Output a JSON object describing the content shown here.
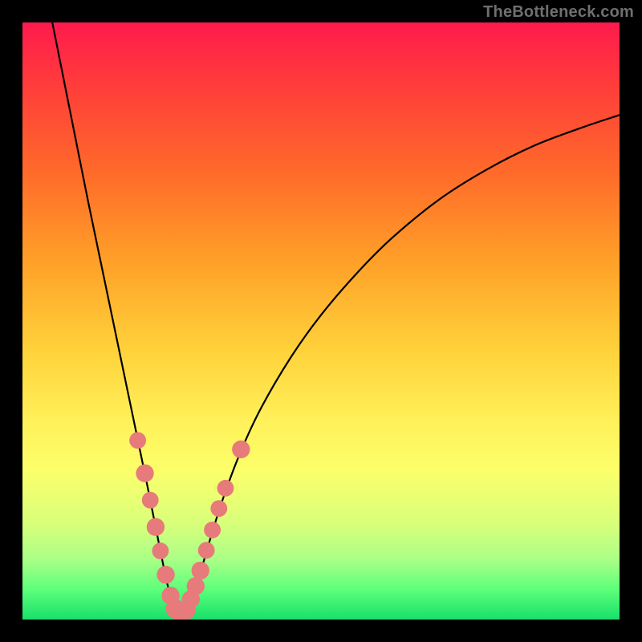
{
  "watermark": "TheBottleneck.com",
  "chart_data": {
    "type": "line",
    "title": "",
    "xlabel": "",
    "ylabel": "",
    "xlim": [
      0,
      100
    ],
    "ylim": [
      0,
      100
    ],
    "note": "Bottleneck-style V curve. X and Y are relative percentages of the plot area. Minimum (best match) is near x≈26.",
    "curve": [
      {
        "x": 5.0,
        "y": 100.0
      },
      {
        "x": 7.0,
        "y": 90.0
      },
      {
        "x": 9.0,
        "y": 80.0
      },
      {
        "x": 11.0,
        "y": 70.0
      },
      {
        "x": 13.5,
        "y": 58.0
      },
      {
        "x": 16.0,
        "y": 46.0
      },
      {
        "x": 18.5,
        "y": 34.0
      },
      {
        "x": 21.0,
        "y": 22.0
      },
      {
        "x": 23.0,
        "y": 12.0
      },
      {
        "x": 24.5,
        "y": 5.0
      },
      {
        "x": 26.0,
        "y": 1.0
      },
      {
        "x": 27.5,
        "y": 1.0
      },
      {
        "x": 29.0,
        "y": 5.0
      },
      {
        "x": 31.0,
        "y": 12.0
      },
      {
        "x": 33.5,
        "y": 20.0
      },
      {
        "x": 36.5,
        "y": 28.0
      },
      {
        "x": 40.0,
        "y": 35.5
      },
      {
        "x": 45.0,
        "y": 44.0
      },
      {
        "x": 50.0,
        "y": 51.0
      },
      {
        "x": 56.0,
        "y": 58.0
      },
      {
        "x": 62.0,
        "y": 64.0
      },
      {
        "x": 70.0,
        "y": 70.5
      },
      {
        "x": 78.0,
        "y": 75.5
      },
      {
        "x": 86.0,
        "y": 79.5
      },
      {
        "x": 94.0,
        "y": 82.5
      },
      {
        "x": 100.0,
        "y": 84.5
      }
    ],
    "markers": [
      {
        "x": 19.3,
        "y": 30.0,
        "r": 1.4
      },
      {
        "x": 20.5,
        "y": 24.5,
        "r": 1.5
      },
      {
        "x": 21.4,
        "y": 20.0,
        "r": 1.4
      },
      {
        "x": 22.3,
        "y": 15.5,
        "r": 1.5
      },
      {
        "x": 23.1,
        "y": 11.5,
        "r": 1.4
      },
      {
        "x": 24.0,
        "y": 7.5,
        "r": 1.5
      },
      {
        "x": 24.8,
        "y": 4.0,
        "r": 1.5
      },
      {
        "x": 25.6,
        "y": 1.8,
        "r": 1.6
      },
      {
        "x": 26.5,
        "y": 1.0,
        "r": 1.6
      },
      {
        "x": 27.4,
        "y": 1.6,
        "r": 1.6
      },
      {
        "x": 28.2,
        "y": 3.4,
        "r": 1.5
      },
      {
        "x": 29.0,
        "y": 5.6,
        "r": 1.5
      },
      {
        "x": 29.8,
        "y": 8.2,
        "r": 1.5
      },
      {
        "x": 30.8,
        "y": 11.6,
        "r": 1.4
      },
      {
        "x": 31.8,
        "y": 15.0,
        "r": 1.4
      },
      {
        "x": 32.9,
        "y": 18.6,
        "r": 1.4
      },
      {
        "x": 34.0,
        "y": 22.0,
        "r": 1.4
      },
      {
        "x": 36.6,
        "y": 28.5,
        "r": 1.5
      }
    ]
  }
}
